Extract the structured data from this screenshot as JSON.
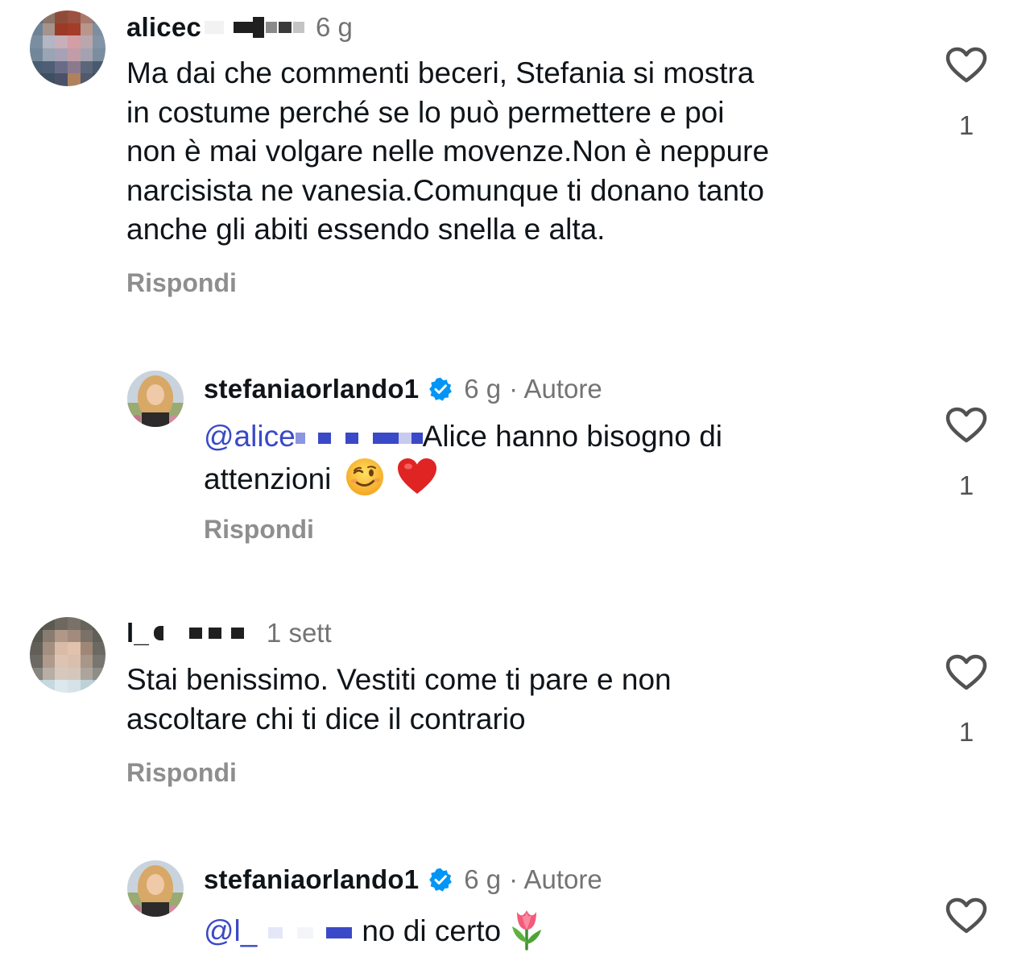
{
  "comments": [
    {
      "username": "alicec",
      "time": "6 g",
      "text": "Ma dai che commenti beceri, Stefania si mostra in costume perché se lo può permettere e poi non è mai volgare nelle movenze.Non è neppure narcisista ne vanesia.Comunque ti donano tanto anche gli abiti essendo snella e alta.",
      "lines": [
        "Ma dai che commenti beceri, Stefania si mostra",
        "in costume perché se lo può permettere e poi",
        "non è mai volgare nelle movenze.Non è neppure",
        "narcisista ne vanesia.Comunque ti donano tanto",
        "anche gli abiti essendo snella e alta."
      ],
      "reply_label": "Rispondi",
      "likes": "1",
      "replies": [
        {
          "username": "stefaniaorlando1",
          "time": "6 g",
          "author_badge": "· Autore",
          "mention": "@alice",
          "text_line1": "Alice hanno bisogno di",
          "text_line2": "attenzioni",
          "emoji": [
            "winking-face",
            "red-heart"
          ],
          "reply_label": "Rispondi",
          "likes": "1"
        }
      ]
    },
    {
      "username": "l_",
      "time": "1 sett",
      "text": "Stai benissimo. Vestiti come ti pare e non ascoltare chi ti dice il contrario",
      "lines": [
        "Stai benissimo. Vestiti come ti pare e non",
        "ascoltare chi ti dice il contrario"
      ],
      "reply_label": "Rispondi",
      "likes": "1",
      "replies": [
        {
          "username": "stefaniaorlando1",
          "time": "6 g",
          "author_badge": "· Autore",
          "mention": "@l_",
          "text_line1": "no di certo",
          "emoji": [
            "tulip"
          ]
        }
      ]
    }
  ],
  "colors": {
    "text": "#0f1419",
    "meta": "#737373",
    "reply": "#8e8e8e",
    "mention": "#3a49c7",
    "verified": "#0095f6"
  },
  "icons": {
    "like": "heart-outline-icon",
    "verified": "verified-badge-icon"
  }
}
